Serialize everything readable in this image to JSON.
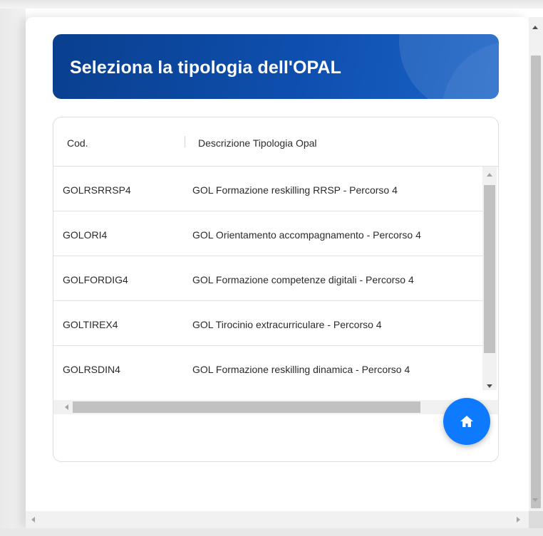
{
  "dialog": {
    "title": "Seleziona la tipologia dell'OPAL"
  },
  "table": {
    "columns": {
      "code": "Cod.",
      "description": "Descrizione Tipologia Opal"
    },
    "rows": [
      {
        "code": "GOLRSRRSP4",
        "description": "GOL Formazione reskilling RRSP - Percorso 4"
      },
      {
        "code": "GOLORI4",
        "description": "GOL Orientamento accompagnamento - Percorso 4"
      },
      {
        "code": "GOLFORDIG4",
        "description": "GOL Formazione competenze digitali - Percorso 4"
      },
      {
        "code": "GOLTIREX4",
        "description": "GOL Tirocinio extracurriculare - Percorso 4"
      },
      {
        "code": "GOLRSDIN4",
        "description": "GOL Formazione reskilling dinamica - Percorso 4"
      }
    ]
  },
  "fab": {
    "icon": "home-icon"
  },
  "colors": {
    "banner_start": "#0a3f8e",
    "banner_end": "#1a63c7",
    "fab": "#0d7aff"
  }
}
